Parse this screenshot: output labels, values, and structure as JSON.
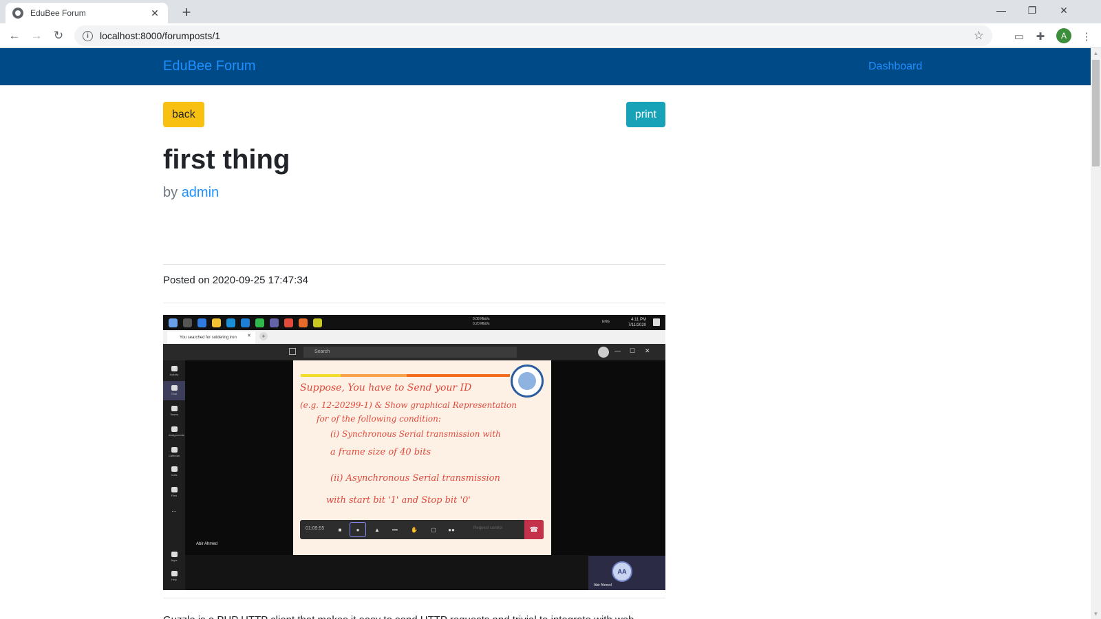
{
  "browser": {
    "tab_title": "EduBee Forum",
    "tab_close": "✕",
    "new_tab": "+",
    "url": "localhost:8000/forumposts/1",
    "info": "i",
    "profile_initial": "A",
    "icons": {
      "back": "arrow-left-icon",
      "forward": "arrow-right-icon",
      "reload": "reload-icon",
      "bookmark": "star-icon",
      "extensions": "puzzle-icon",
      "menu": "kebab-menu-icon"
    }
  },
  "site": {
    "brand": "EduBee Forum",
    "nav_link": "Dashboard",
    "colors": {
      "navbar": "#004a87",
      "link": "#1e90ff",
      "back_button": "#f8c112",
      "print_button": "#17a2b8"
    }
  },
  "post": {
    "back_label": "back",
    "print_label": "print",
    "title": "first thing",
    "by_prefix": "by",
    "author": "admin",
    "posted": "Posted on 2020-09-25 17:47:34",
    "body": "Guzzle is a PHP HTTP client that makes it easy to send HTTP requests and trivial to integrate with web services."
  },
  "image": {
    "browser_tab": "You searched for soldering iron",
    "search": "Search",
    "clock_time": "4:11 PM",
    "clock_date": "7/11/2020",
    "net_up": "0.08 Mbit/s",
    "net_down": "0.20 Mbit/s",
    "lang": "ENG",
    "rail": [
      "Activity",
      "Chat",
      "Teams",
      "Assignments",
      "Calendar",
      "Calls",
      "Files",
      "...",
      "Apps",
      "Help"
    ],
    "whiteboard_lines": [
      "Suppose, You have to Send your ID",
      "(e.g. 12-20299-1) & Show graphical Representation",
      "for of the following condition:",
      "(i) Synchronous Serial transmission with",
      "a frame size of 40 bits",
      "(ii) Asynchronous Serial transmission",
      "with start bit '1' and Stop bit '0'"
    ],
    "call_timer": "01:09:55",
    "request_control": "Request control",
    "presenter": "Abir Ahmed",
    "tile_initials": "AA",
    "tile_name": "Abir Ahmed"
  }
}
